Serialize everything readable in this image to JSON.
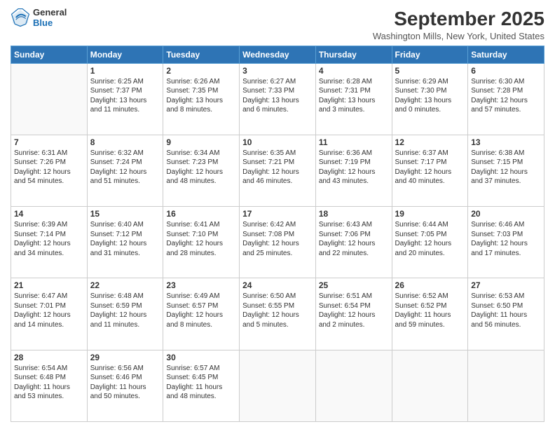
{
  "header": {
    "logo": {
      "line1": "General",
      "line2": "Blue"
    },
    "title": "September 2025",
    "subtitle": "Washington Mills, New York, United States"
  },
  "weekdays": [
    "Sunday",
    "Monday",
    "Tuesday",
    "Wednesday",
    "Thursday",
    "Friday",
    "Saturday"
  ],
  "weeks": [
    [
      {
        "day": "",
        "info": ""
      },
      {
        "day": "1",
        "info": "Sunrise: 6:25 AM\nSunset: 7:37 PM\nDaylight: 13 hours\nand 11 minutes."
      },
      {
        "day": "2",
        "info": "Sunrise: 6:26 AM\nSunset: 7:35 PM\nDaylight: 13 hours\nand 8 minutes."
      },
      {
        "day": "3",
        "info": "Sunrise: 6:27 AM\nSunset: 7:33 PM\nDaylight: 13 hours\nand 6 minutes."
      },
      {
        "day": "4",
        "info": "Sunrise: 6:28 AM\nSunset: 7:31 PM\nDaylight: 13 hours\nand 3 minutes."
      },
      {
        "day": "5",
        "info": "Sunrise: 6:29 AM\nSunset: 7:30 PM\nDaylight: 13 hours\nand 0 minutes."
      },
      {
        "day": "6",
        "info": "Sunrise: 6:30 AM\nSunset: 7:28 PM\nDaylight: 12 hours\nand 57 minutes."
      }
    ],
    [
      {
        "day": "7",
        "info": "Sunrise: 6:31 AM\nSunset: 7:26 PM\nDaylight: 12 hours\nand 54 minutes."
      },
      {
        "day": "8",
        "info": "Sunrise: 6:32 AM\nSunset: 7:24 PM\nDaylight: 12 hours\nand 51 minutes."
      },
      {
        "day": "9",
        "info": "Sunrise: 6:34 AM\nSunset: 7:23 PM\nDaylight: 12 hours\nand 48 minutes."
      },
      {
        "day": "10",
        "info": "Sunrise: 6:35 AM\nSunset: 7:21 PM\nDaylight: 12 hours\nand 46 minutes."
      },
      {
        "day": "11",
        "info": "Sunrise: 6:36 AM\nSunset: 7:19 PM\nDaylight: 12 hours\nand 43 minutes."
      },
      {
        "day": "12",
        "info": "Sunrise: 6:37 AM\nSunset: 7:17 PM\nDaylight: 12 hours\nand 40 minutes."
      },
      {
        "day": "13",
        "info": "Sunrise: 6:38 AM\nSunset: 7:15 PM\nDaylight: 12 hours\nand 37 minutes."
      }
    ],
    [
      {
        "day": "14",
        "info": "Sunrise: 6:39 AM\nSunset: 7:14 PM\nDaylight: 12 hours\nand 34 minutes."
      },
      {
        "day": "15",
        "info": "Sunrise: 6:40 AM\nSunset: 7:12 PM\nDaylight: 12 hours\nand 31 minutes."
      },
      {
        "day": "16",
        "info": "Sunrise: 6:41 AM\nSunset: 7:10 PM\nDaylight: 12 hours\nand 28 minutes."
      },
      {
        "day": "17",
        "info": "Sunrise: 6:42 AM\nSunset: 7:08 PM\nDaylight: 12 hours\nand 25 minutes."
      },
      {
        "day": "18",
        "info": "Sunrise: 6:43 AM\nSunset: 7:06 PM\nDaylight: 12 hours\nand 22 minutes."
      },
      {
        "day": "19",
        "info": "Sunrise: 6:44 AM\nSunset: 7:05 PM\nDaylight: 12 hours\nand 20 minutes."
      },
      {
        "day": "20",
        "info": "Sunrise: 6:46 AM\nSunset: 7:03 PM\nDaylight: 12 hours\nand 17 minutes."
      }
    ],
    [
      {
        "day": "21",
        "info": "Sunrise: 6:47 AM\nSunset: 7:01 PM\nDaylight: 12 hours\nand 14 minutes."
      },
      {
        "day": "22",
        "info": "Sunrise: 6:48 AM\nSunset: 6:59 PM\nDaylight: 12 hours\nand 11 minutes."
      },
      {
        "day": "23",
        "info": "Sunrise: 6:49 AM\nSunset: 6:57 PM\nDaylight: 12 hours\nand 8 minutes."
      },
      {
        "day": "24",
        "info": "Sunrise: 6:50 AM\nSunset: 6:55 PM\nDaylight: 12 hours\nand 5 minutes."
      },
      {
        "day": "25",
        "info": "Sunrise: 6:51 AM\nSunset: 6:54 PM\nDaylight: 12 hours\nand 2 minutes."
      },
      {
        "day": "26",
        "info": "Sunrise: 6:52 AM\nSunset: 6:52 PM\nDaylight: 11 hours\nand 59 minutes."
      },
      {
        "day": "27",
        "info": "Sunrise: 6:53 AM\nSunset: 6:50 PM\nDaylight: 11 hours\nand 56 minutes."
      }
    ],
    [
      {
        "day": "28",
        "info": "Sunrise: 6:54 AM\nSunset: 6:48 PM\nDaylight: 11 hours\nand 53 minutes."
      },
      {
        "day": "29",
        "info": "Sunrise: 6:56 AM\nSunset: 6:46 PM\nDaylight: 11 hours\nand 50 minutes."
      },
      {
        "day": "30",
        "info": "Sunrise: 6:57 AM\nSunset: 6:45 PM\nDaylight: 11 hours\nand 48 minutes."
      },
      {
        "day": "",
        "info": ""
      },
      {
        "day": "",
        "info": ""
      },
      {
        "day": "",
        "info": ""
      },
      {
        "day": "",
        "info": ""
      }
    ]
  ]
}
